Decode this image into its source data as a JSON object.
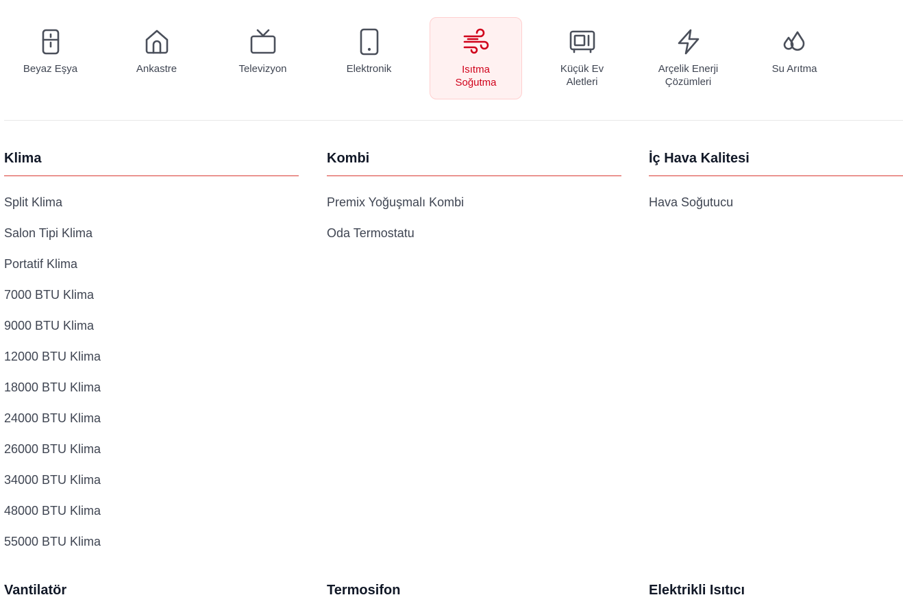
{
  "categories": [
    {
      "label": "Beyaz Eşya",
      "icon": "fridge-icon"
    },
    {
      "label": "Ankastre",
      "icon": "home-icon"
    },
    {
      "label": "Televizyon",
      "icon": "tv-icon"
    },
    {
      "label": "Elektronik",
      "icon": "phone-icon"
    },
    {
      "label": "Isıtma Soğutma",
      "icon": "wind-icon",
      "active": true
    },
    {
      "label": "Küçük Ev Aletleri",
      "icon": "microwave-icon"
    },
    {
      "label": "Arçelik Enerji Çözümleri",
      "icon": "lightning-icon"
    },
    {
      "label": "Su Arıtma",
      "icon": "droplets-icon"
    }
  ],
  "colors": {
    "accent": "#d0021b",
    "active_bg": "#fff1f1",
    "text": "#3f4552"
  },
  "sections": [
    {
      "title": "Klima",
      "items": [
        "Split Klima",
        "Salon Tipi Klima",
        "Portatif Klima",
        "7000 BTU Klima",
        "9000 BTU Klima",
        "12000 BTU Klima",
        "18000 BTU Klima",
        "24000 BTU Klima",
        "26000 BTU Klima",
        "34000 BTU Klima",
        "48000 BTU Klima",
        "55000 BTU Klima"
      ]
    },
    {
      "title": "Kombi",
      "items": [
        "Premix Yoğuşmalı Kombi",
        "Oda Termostatu"
      ]
    },
    {
      "title": "İç Hava Kalitesi",
      "items": [
        "Hava Soğutucu"
      ]
    }
  ],
  "more_sections": [
    "Vantilatör",
    "Termosifon",
    "Elektrikli Isıtıcı"
  ]
}
